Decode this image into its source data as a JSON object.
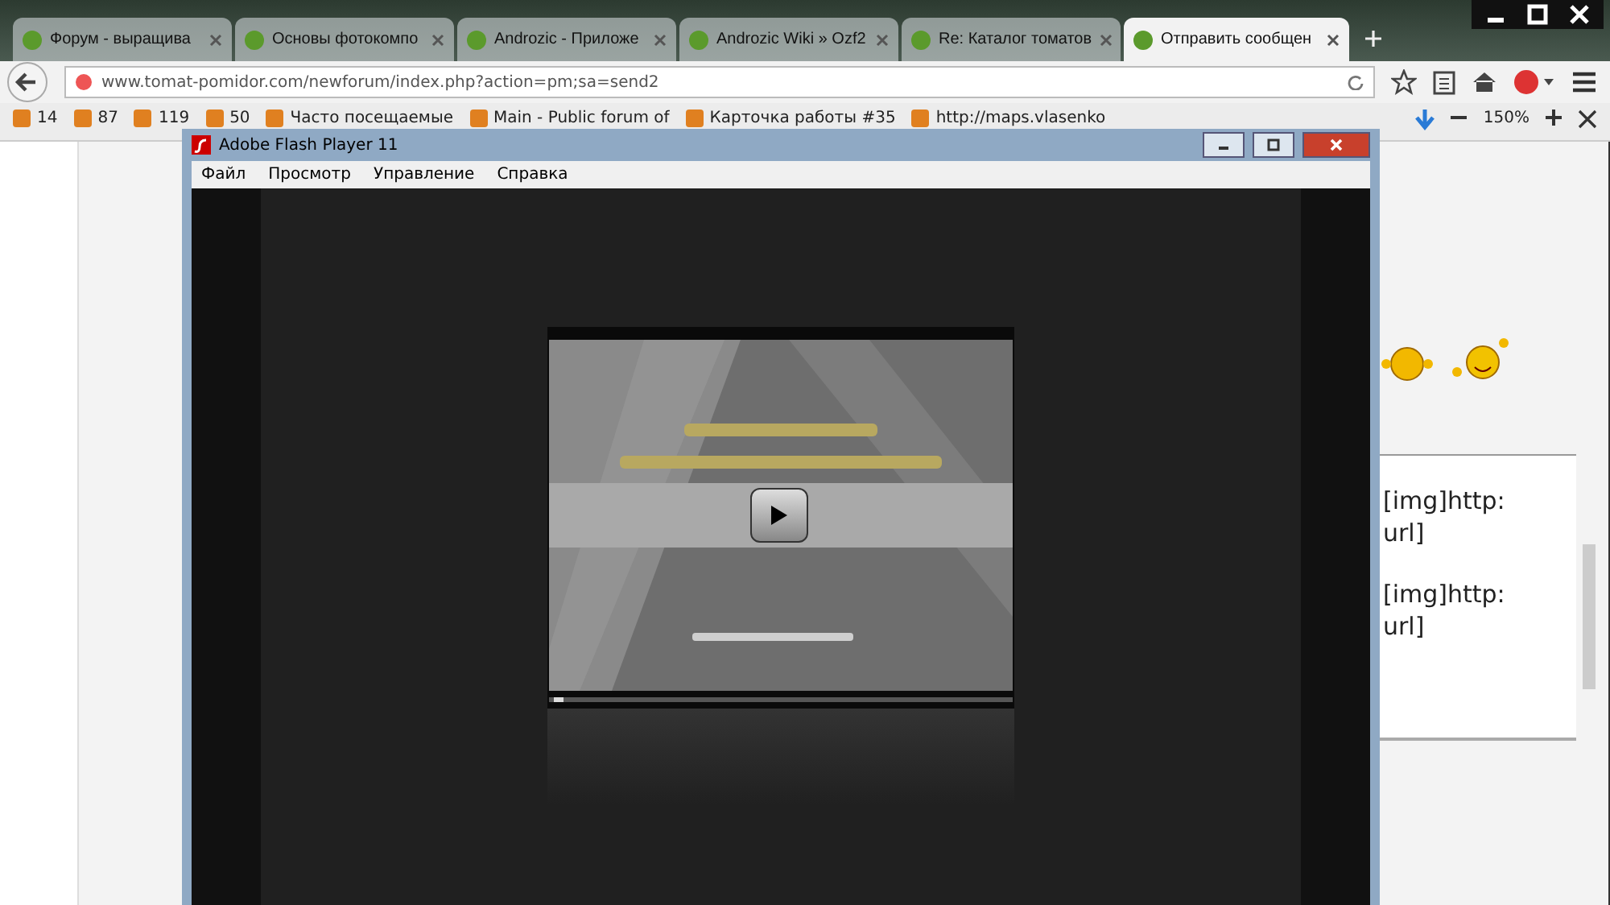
{
  "browser": {
    "tabs": [
      {
        "label": "Форум - выращива",
        "selected": false
      },
      {
        "label": "Основы фотокомпо",
        "selected": false
      },
      {
        "label": "Androzic - Приложе",
        "selected": false
      },
      {
        "label": "Androzic Wiki » Ozf2",
        "selected": false
      },
      {
        "label": "Re: Каталог томатов",
        "selected": false
      },
      {
        "label": "Отправить сообщен",
        "selected": true
      }
    ],
    "address": "www.tomat-pomidor.com/newforum/index.php?action=pm;sa=send2",
    "bookmarks": [
      {
        "label": "14"
      },
      {
        "label": "87"
      },
      {
        "label": "119"
      },
      {
        "label": "50"
      },
      {
        "label": "Часто посещаемые"
      },
      {
        "label": "Main - Public forum of"
      },
      {
        "label": "Карточка работы #35"
      },
      {
        "label": "http://maps.vlasenko"
      }
    ],
    "zoom": "150%"
  },
  "page": {
    "posts": [
      {
        "lines": [
          "[img]http:",
          "url]"
        ]
      },
      {
        "lines": [
          "[img]http:",
          "url]"
        ]
      }
    ]
  },
  "flash_window": {
    "title": "Adobe Flash Player 11",
    "menu": [
      "Файл",
      "Просмотр",
      "Управление",
      "Справка"
    ]
  }
}
